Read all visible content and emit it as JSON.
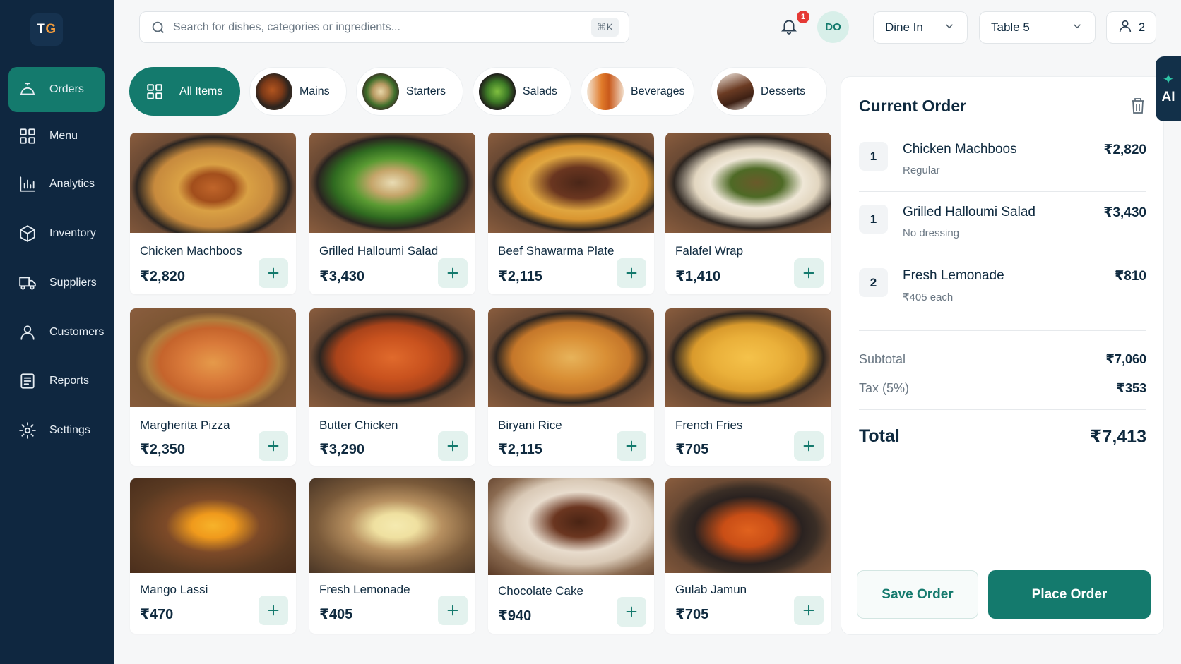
{
  "brand": {
    "logo_t": "T",
    "logo_g": "G",
    "accent": "#147a6d",
    "logo_accent": "#f39c3c",
    "sidebar_bg": "#0f2740"
  },
  "sidebar": {
    "items": [
      {
        "label": "Orders",
        "icon": "cloche-icon",
        "active": true
      },
      {
        "label": "Menu",
        "icon": "grid-icon",
        "active": false
      },
      {
        "label": "Analytics",
        "icon": "bar-chart-icon",
        "active": false
      },
      {
        "label": "Inventory",
        "icon": "box-icon",
        "active": false
      },
      {
        "label": "Suppliers",
        "icon": "truck-icon",
        "active": false
      },
      {
        "label": "Customers",
        "icon": "users-icon",
        "active": false
      },
      {
        "label": "Reports",
        "icon": "report-icon",
        "active": false
      },
      {
        "label": "Settings",
        "icon": "gear-icon",
        "active": false
      }
    ]
  },
  "header": {
    "search_placeholder": "Search for dishes, categories or ingredients...",
    "search_shortcut": "⌘K",
    "notification_count": "1",
    "avatar_initials": "DO",
    "service_mode": "Dine In",
    "table": "Table 5",
    "guests": "2"
  },
  "categories": [
    {
      "label": "All Items",
      "active": true
    },
    {
      "label": "Mains",
      "active": false
    },
    {
      "label": "Starters",
      "active": false
    },
    {
      "label": "Salads",
      "active": false
    },
    {
      "label": "Beverages",
      "active": false
    },
    {
      "label": "Desserts",
      "active": false
    }
  ],
  "products": [
    {
      "name": "Chicken Machboos",
      "price": "₹2,820"
    },
    {
      "name": "Grilled Halloumi Salad",
      "price": "₹3,430"
    },
    {
      "name": "Beef Shawarma Plate",
      "price": "₹2,115"
    },
    {
      "name": "Falafel Wrap",
      "price": "₹1,410"
    },
    {
      "name": "Margherita Pizza",
      "price": "₹2,350"
    },
    {
      "name": "Butter Chicken",
      "price": "₹3,290"
    },
    {
      "name": "Biryani Rice",
      "price": "₹2,115"
    },
    {
      "name": "French Fries",
      "price": "₹705"
    },
    {
      "name": "Mango Lassi",
      "price": "₹470"
    },
    {
      "name": "Fresh Lemonade",
      "price": "₹405"
    },
    {
      "name": "Chocolate Cake",
      "price": "₹940"
    },
    {
      "name": "Gulab Jamun",
      "price": "₹705"
    }
  ],
  "order": {
    "title": "Current Order",
    "items": [
      {
        "qty": "1",
        "name": "Chicken Machboos",
        "note": "Regular",
        "price": "₹2,820"
      },
      {
        "qty": "1",
        "name": "Grilled Halloumi Salad",
        "note": "No dressing",
        "price": "₹3,430"
      },
      {
        "qty": "2",
        "name": "Fresh Lemonade",
        "note": "₹405 each",
        "price": "₹810"
      }
    ],
    "subtotal_label": "Subtotal",
    "subtotal": "₹7,060",
    "tax_label": "Tax (5%)",
    "tax": "₹353",
    "total_label": "Total",
    "total": "₹7,413",
    "save_label": "Save Order",
    "place_label": "Place Order"
  },
  "ai_tab": {
    "label": "AI"
  }
}
